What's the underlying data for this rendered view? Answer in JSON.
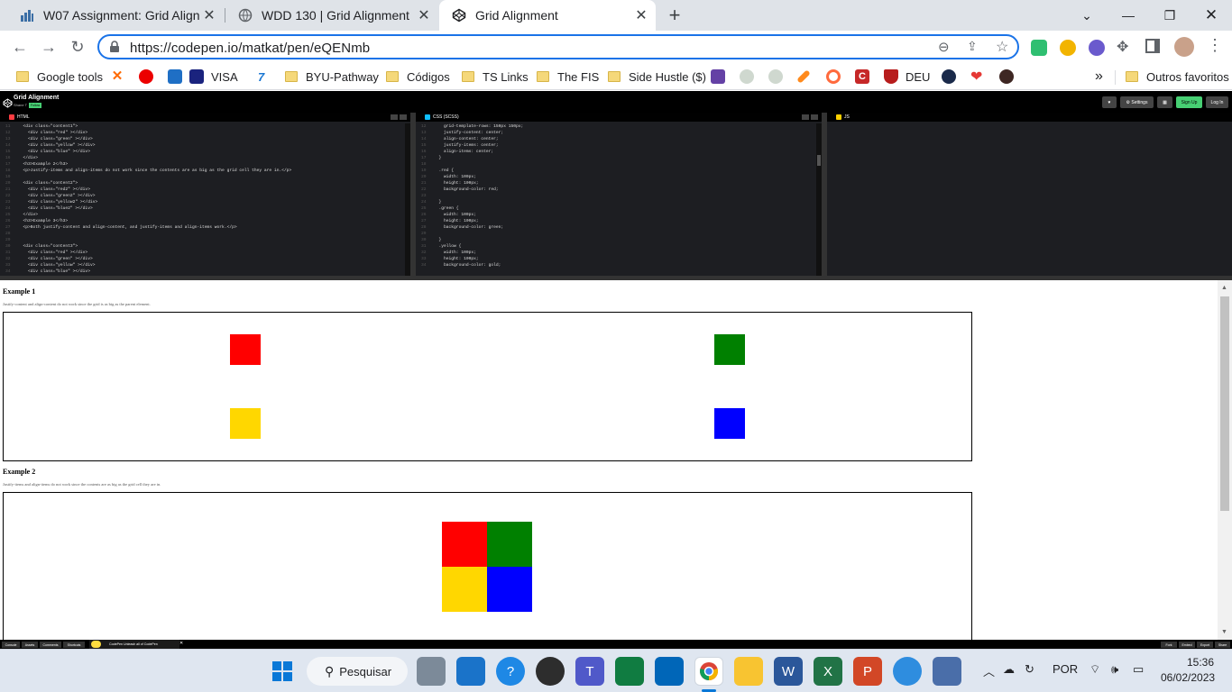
{
  "browser": {
    "tabs": [
      {
        "title": "W07 Assignment: Grid Alignment",
        "icon": "canvas-icon",
        "active": false
      },
      {
        "title": "WDD 130 | Grid Alignment",
        "icon": "globe-icon",
        "active": false
      },
      {
        "title": "Grid Alignment",
        "icon": "codepen-icon",
        "active": true
      }
    ],
    "new_tab": "+",
    "url": "https://codepen.io/matkat/pen/eQENmb",
    "bookmarks": [
      {
        "label": "Google tools",
        "type": "folder"
      },
      {
        "label": "",
        "type": "site",
        "icon": "xinput-icon"
      },
      {
        "label": "",
        "type": "site",
        "icon": "santander-icon"
      },
      {
        "label": "VISA",
        "type": "site",
        "icon": "amex-icon"
      },
      {
        "label": "",
        "type": "site",
        "icon": "seven-icon"
      },
      {
        "label": "BYU-Pathway",
        "type": "folder"
      },
      {
        "label": "Códigos",
        "type": "folder"
      },
      {
        "label": "TS Links",
        "type": "folder"
      },
      {
        "label": "The FIS",
        "type": "folder"
      },
      {
        "label": "Side Hustle ($)",
        "type": "folder"
      },
      {
        "label": "DEU",
        "type": "site",
        "icon": "shield-icon"
      },
      {
        "label": "»",
        "type": "more"
      },
      {
        "label": "Outros favoritos",
        "type": "folder"
      }
    ]
  },
  "codepen": {
    "title": "Grid Alignment",
    "author": "Shane T",
    "badge": "Follow",
    "buttons": {
      "heart": "♥",
      "settings": "⚙ Settings",
      "view": "▦",
      "signup": "Sign Up",
      "login": "Log In"
    },
    "panes": [
      {
        "name": "HTML",
        "color": "#ff3c41"
      },
      {
        "name": "CSS (SCSS)",
        "color": "#0ebeff"
      },
      {
        "name": "JS",
        "color": "#fcd000"
      }
    ],
    "html_lines": [
      "  <div class=\"content1\">",
      "    <div class=\"red\" ></div>",
      "    <div class=\"green\" ></div>",
      "    <div class=\"yellow\" ></div>",
      "    <div class=\"blue\" ></div>",
      "  </div>",
      "  <h3>Example 2</h3>",
      "  <p>Justify-items and align-items do not work since the contents are as big as the grid cell they are in.</p>",
      "",
      "  <div class=\"content2\">",
      "    <div class=\"red2\" ></div>",
      "    <div class=\"green2\" ></div>",
      "    <div class=\"yellow2\" ></div>",
      "    <div class=\"blue2\" ></div>",
      "  </div>",
      "  <h3>Example 3</h3>",
      "  <p>Both justify-content and align-content, and justify-items and align-items work.</p>",
      "",
      "",
      "  <div class=\"content3\">",
      "    <div class=\"red\" ></div>",
      "    <div class=\"green\" ></div>",
      "    <div class=\"yellow\" ></div>",
      "    <div class=\"blue\" ></div>"
    ],
    "css_lines": [
      "    grid-template-rows: 150px 150px;",
      "    justify-content: center;",
      "    align-content: center;",
      "    justify-items: center;",
      "    align-items: center;",
      "  }",
      "",
      "  .red {",
      "    width: 100px;",
      "    height: 100px;",
      "    background-color: red;",
      "",
      "  }",
      "  .green {",
      "    width: 100px;",
      "    height: 100px;",
      "    background-color: green;",
      "",
      "  }",
      "  .yellow {",
      "    width: 100px;",
      "    height: 100px;",
      "    background-color: gold;"
    ],
    "footer_buttons": [
      "Console",
      "Assets",
      "Comments",
      "Shortcuts"
    ],
    "footer_promo": "CodePen Unleash all of CodePen",
    "footer_right": [
      "Fork",
      "Embed",
      "Export",
      "Share"
    ]
  },
  "result": {
    "example1": {
      "heading": "Example 1",
      "text": "Justify-content and align-content do not work since the grid is as big as the parent element."
    },
    "example2": {
      "heading": "Example 2",
      "text": "Justify-items and align-items do not work since the contents are as big as the grid cell they are in."
    }
  },
  "colors": {
    "red": "#ff0000",
    "green": "#008000",
    "gold": "#ffd700",
    "blue": "#0000ff",
    "accent": "#1a73e8"
  },
  "taskbar": {
    "search": "Pesquisar",
    "lang": "POR",
    "time": "15:36",
    "date": "06/02/2023"
  }
}
